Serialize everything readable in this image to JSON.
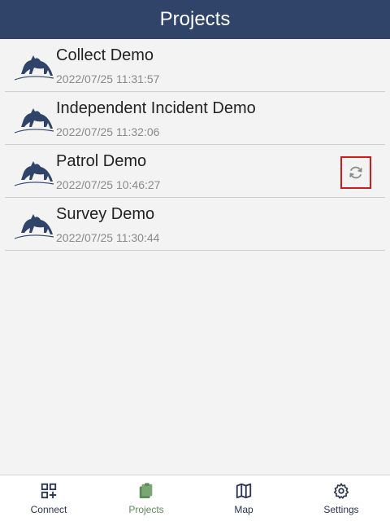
{
  "header": {
    "title": "Projects"
  },
  "projects": [
    {
      "name": "Collect Demo",
      "date": "2022/07/25 11:31:57"
    },
    {
      "name": "Independent Incident Demo",
      "date": "2022/07/25 11:32:06"
    },
    {
      "name": "Patrol Demo",
      "date": "2022/07/25 10:46:27",
      "sync_icon": "sync-icon"
    },
    {
      "name": "Survey Demo",
      "date": "2022/07/25 11:30:44"
    }
  ],
  "nav": {
    "items": [
      {
        "label": "Connect",
        "icon": "qr-add-icon"
      },
      {
        "label": "Projects",
        "icon": "clipboard-icon",
        "active": true
      },
      {
        "label": "Map",
        "icon": "map-icon"
      },
      {
        "label": "Settings",
        "icon": "gear-icon"
      }
    ]
  },
  "colors": {
    "header_bg": "#2f4468",
    "accent_active": "#5f8a5a",
    "highlight_border": "#d11b1b"
  }
}
